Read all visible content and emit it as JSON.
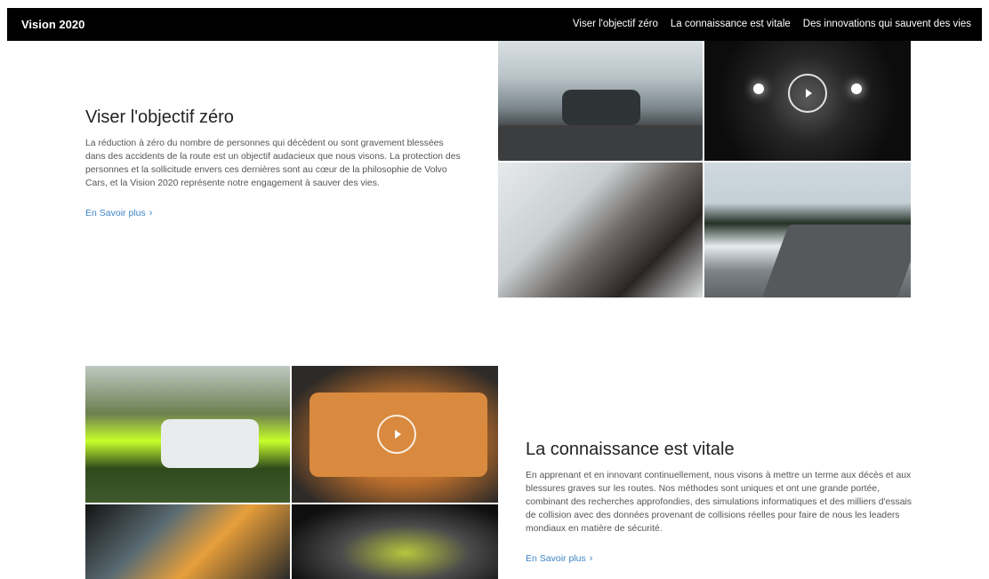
{
  "header": {
    "brand": "Vision 2020",
    "nav": [
      "Viser l'objectif zéro",
      "La connaissance est vitale",
      "Des innovations qui sauvent des vies"
    ]
  },
  "sections": [
    {
      "title": "Viser l'objectif zéro",
      "paragraph": "La réduction à zéro du nombre de personnes qui décèdent ou sont gravement blessées dans des accidents de la route est un objectif audacieux que nous visons. La protection des personnes et la sollicitude envers ces dernières sont au cœur de la philosophie de Volvo Cars, et la Vision 2020 représente notre engagement à sauver des vies.",
      "link": "En Savoir plus"
    },
    {
      "title": "La connaissance est vitale",
      "paragraph": "En apprenant et en innovant continuellement, nous visons à mettre un terme aux décès et aux blessures graves sur les routes. Nos méthodes sont uniques et ont une grande portée, combinant des recherches approfondies, des simulations informatiques et des milliers d'essais de collision avec des données provenant de collisions réelles pour faire de nous les leaders mondiaux en matière de sécurité.",
      "link": "En Savoir plus"
    }
  ],
  "icons": {
    "link_chevron": "chevron-right-icon",
    "video": "play-icon"
  }
}
